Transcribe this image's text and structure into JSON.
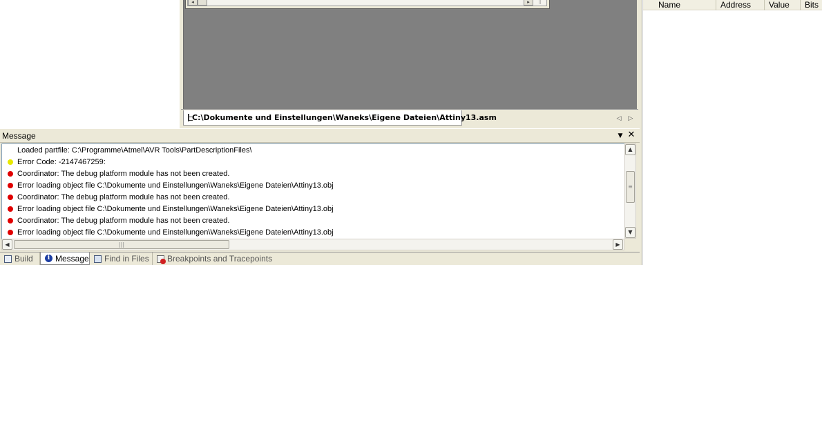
{
  "editor": {
    "tab_title": "C:\\Dokumente und Einstellungen\\Waneks\\Eigene Dateien\\Attiny13.asm",
    "nav_left": "◁",
    "nav_right": "▷"
  },
  "io_view": {
    "columns": [
      "Name",
      "Address",
      "Value",
      "Bits"
    ]
  },
  "message_panel": {
    "title": "Message",
    "dropdown_glyph": "▼",
    "close_glyph": "✕",
    "colors": {
      "info": "#ffffff",
      "warning": "#e8e800",
      "error": "#e00000"
    },
    "messages": [
      {
        "severity": "info",
        "text": "Loaded partfile: C:\\Programme\\Atmel\\AVR Tools\\PartDescriptionFiles\\"
      },
      {
        "severity": "warning",
        "text": "Error Code: -2147467259:"
      },
      {
        "severity": "error",
        "text": "Coordinator: The debug platform module has not been created."
      },
      {
        "severity": "error",
        "text": "Error loading object file C:\\Dokumente und Einstellungen\\Waneks\\Eigene Dateien\\Attiny13.obj"
      },
      {
        "severity": "error",
        "text": "Coordinator: The debug platform module has not been created."
      },
      {
        "severity": "error",
        "text": "Error loading object file C:\\Dokumente und Einstellungen\\Waneks\\Eigene Dateien\\Attiny13.obj"
      },
      {
        "severity": "error",
        "text": "Coordinator: The debug platform module has not been created."
      },
      {
        "severity": "error",
        "text": "Error loading object file C:\\Dokumente und Einstellungen\\Waneks\\Eigene Dateien\\Attiny13.obj"
      }
    ]
  },
  "bottom_tabs": [
    {
      "label": "Build",
      "icon": "build-icon",
      "active": false
    },
    {
      "label": "Message",
      "icon": "info-icon",
      "active": true
    },
    {
      "label": "Find in Files",
      "icon": "find-in-files-icon",
      "active": false
    },
    {
      "label": "Breakpoints and Tracepoints",
      "icon": "breakpoint-icon",
      "active": false
    }
  ]
}
